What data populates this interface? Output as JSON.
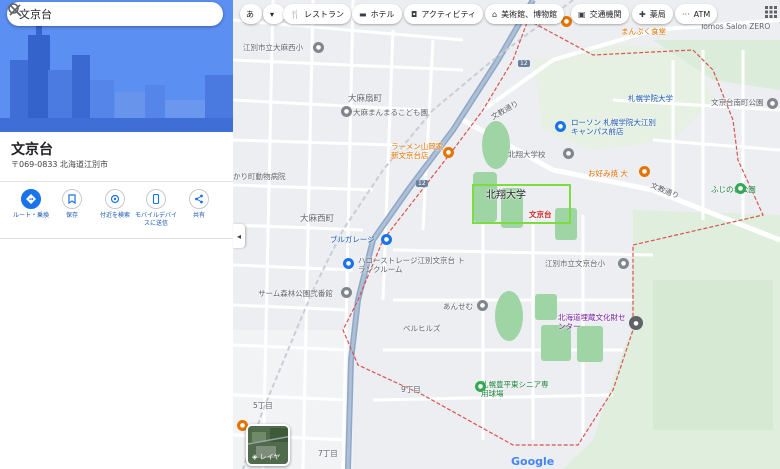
{
  "search": {
    "query": "文京台"
  },
  "place": {
    "title": "文京台",
    "address": "〒069-0833 北海道江別市"
  },
  "actions": [
    {
      "label": "ルート・乗換"
    },
    {
      "label": "保存"
    },
    {
      "label": "付近を検索"
    },
    {
      "label": "モバイルデバイスに送信"
    },
    {
      "label": "共有"
    }
  ],
  "chips": {
    "lang": "あ",
    "items": [
      {
        "label": "レストラン",
        "icon": "fork-knife-icon"
      },
      {
        "label": "ホテル",
        "icon": "bed-icon"
      },
      {
        "label": "アクティビティ",
        "icon": "camera-icon"
      },
      {
        "label": "美術館、博物館",
        "icon": "museum-icon"
      },
      {
        "label": "交通機関",
        "icon": "train-icon"
      },
      {
        "label": "薬局",
        "icon": "pharmacy-icon"
      },
      {
        "label": "ATM",
        "icon": "more-icon"
      }
    ]
  },
  "map": {
    "labels": {
      "school_oasa_west": "江別市立大麻西小",
      "oasa_higashi": "大麻扇町",
      "oasa_kodomoen": "大麻まんまるこども園",
      "ramen": "ラーメン山岡家 新文京台店",
      "bunkyo_road": "文教通り",
      "sapporo_gakuin": "札幌学院大学",
      "lawson": "ローソン 札幌学院大江別キャンパス前店",
      "hokushou_hs": "北翔大学校",
      "bunkyodai_town": "文京台南町公園",
      "okonomiyaki": "お好み焼 大",
      "fujinoki": "ふじのき公園",
      "hokushou_univ": "北翔大学",
      "bunkyodai_red": "文京台",
      "oasa_nishi": "大麻西町",
      "garage": "ブルガレージ",
      "storage": "ハローストレージ江別文京台 トランクルーム",
      "bunkyodai_elem": "江別市立文京台小",
      "samu_forest": "サーム森林公園弐番館",
      "anseimu": "あんせむ",
      "bellhills": "ベルヒルズ",
      "maizou": "北海道埋蔵文化財センター",
      "senior": "札幌豊平東シニア専用球場",
      "ninth": "9丁目",
      "fifth": "5丁目",
      "seventh": "7丁目",
      "manpuku": "まんぷく食堂",
      "tomos": "Tomos Salon ZERO",
      "road_sign_12": "12",
      "road_sign_12b": "12",
      "katayama": "かり町動物病院"
    }
  },
  "layers": {
    "label": "レイヤ"
  },
  "branding": {
    "logo": "Google"
  },
  "colors": {
    "accent": "#1a73e8",
    "boundary": "#d9534f",
    "park": "#c8e6c9",
    "highway": "#8ea8c7"
  }
}
